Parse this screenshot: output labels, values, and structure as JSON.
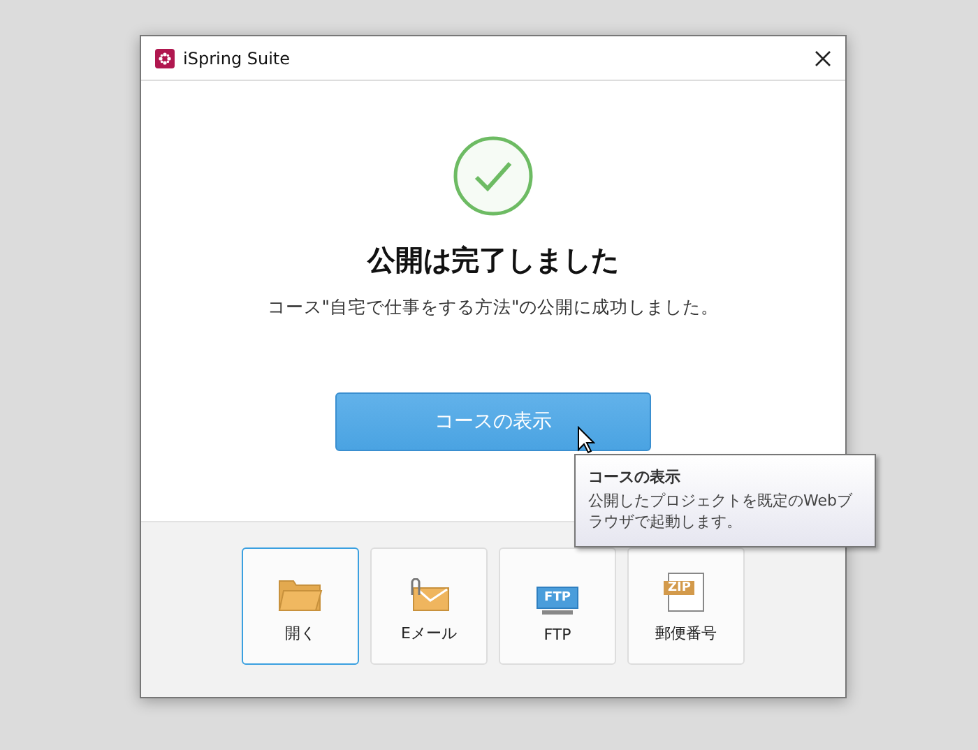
{
  "window": {
    "title": "iSpring Suite"
  },
  "result": {
    "heading": "公開は完了しました",
    "message": "コース\"自宅で仕事をする方法\"の公開に成功しました。"
  },
  "primary_button": {
    "label": "コースの表示"
  },
  "tooltip": {
    "title": "コースの表示",
    "text": "公開したプロジェクトを既定のWebブラウザで起動します。"
  },
  "actions": [
    {
      "kind": "folder",
      "label": "開く",
      "selected": true
    },
    {
      "kind": "email",
      "label": "Eメール",
      "selected": false
    },
    {
      "kind": "ftp",
      "label": "FTP",
      "icon_text": "FTP",
      "selected": false
    },
    {
      "kind": "zip",
      "label": "郵便番号",
      "icon_text": "ZIP",
      "selected": false
    }
  ]
}
